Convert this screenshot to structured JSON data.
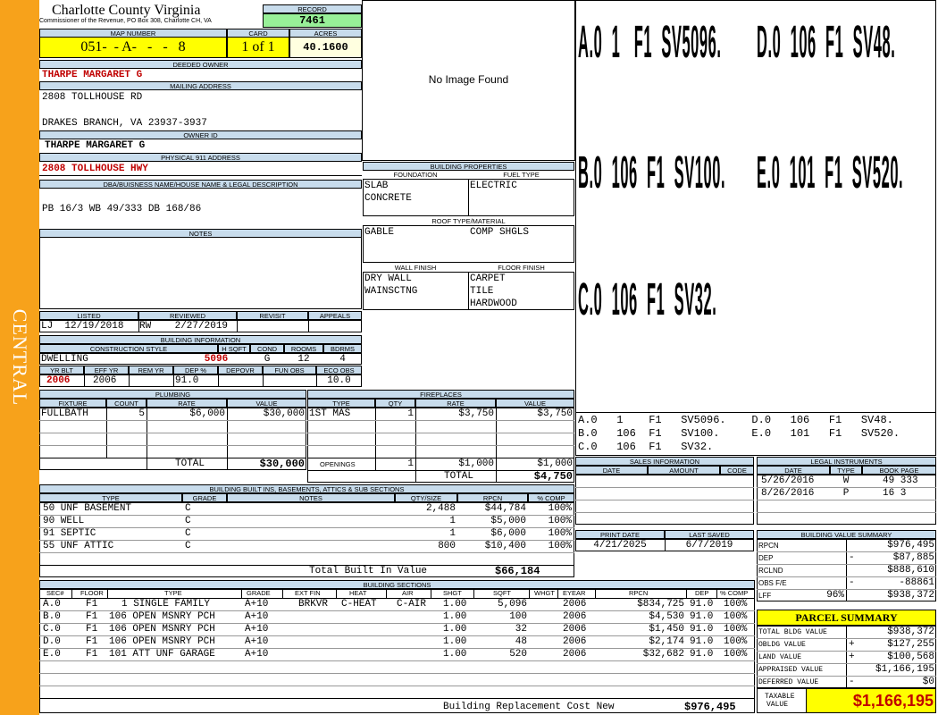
{
  "sidebar": {
    "label": "CENTRAL"
  },
  "county": {
    "name": "Charlotte County Virginia",
    "address": "Commissioner of the Revenue, PO Box 308, Charlotte CH, VA"
  },
  "record": {
    "label": "RECORD",
    "value": "7461"
  },
  "map": {
    "label": "MAP NUMBER",
    "value": "051-  - A-   -   -   8"
  },
  "card": {
    "label": "CARD",
    "value": "1 of 1"
  },
  "acres": {
    "label": "ACRES",
    "value": "40.1600"
  },
  "owner": {
    "deeded_label": "DEEDED OWNER",
    "deeded": "THARPE MARGARET G",
    "mailing_label": "MAILING ADDRESS",
    "mail1": "2808 TOLLHOUSE RD",
    "mail2": "DRAKES BRANCH, VA 23937-3937",
    "ownerid_label": "OWNER ID",
    "ownerid": "THARPE MARGARET G",
    "phys_label": "PHYSICAL 911 ADDRESS",
    "phys": "2808 TOLLHOUSE HWY"
  },
  "legal": {
    "label": "DBA/BUISNESS NAME/HOUSE NAME & LEGAL DESCRIPTION",
    "text": "PB 16/3 WB 49/333 DB 168/86"
  },
  "notes": {
    "label": "NOTES"
  },
  "listed": {
    "listed_label": "LISTED",
    "reviewed_label": "REVIEWED",
    "revisit_label": "REVISIT",
    "appeals_label": "APPEALS",
    "listed": "LJ  12/19/2018",
    "reviewed": "RW    2/27/2019"
  },
  "bldg_info": {
    "label": "BUILDING INFORMATION",
    "style_label": "CONSTRUCTION STYLE",
    "hsqft_label": "H SQFT",
    "cond_label": "COND",
    "rooms_label": "ROOMS",
    "bdrms_label": "BDRMS",
    "style": "DWELLING",
    "hsqft": "5096",
    "cond": "G",
    "rooms": "12",
    "bdrms": "4",
    "yrblt_label": "YR BLT",
    "effyr_label": "EFF YR",
    "remyr_label": "REM YR",
    "dep_label": "DEP %",
    "depovr_label": "DEPOVR",
    "funobs_label": "FUN OBS",
    "ecoobs_label": "ECO OBS",
    "yrblt": "2006",
    "effyr": "2006",
    "dep": "91.0",
    "ecoobs": "10.0"
  },
  "image": {
    "text": "No Image Found"
  },
  "bldg_props": {
    "label": "BUILDING PROPERTIES",
    "foundation_label": "FOUNDATION",
    "fuel_label": "FUEL TYPE",
    "foundation1": "SLAB",
    "foundation2": "CONCRETE",
    "fuel": "ELECTRIC",
    "roof_label": "ROOF TYPE/MATERIAL",
    "roof1": "GABLE",
    "roof2": "COMP SHGLS",
    "wall_label": "WALL FINISH",
    "floor_label": "FLOOR FINISH",
    "wall1": "DRY WALL",
    "wall2": "WAINSCTNG",
    "floor1": "CARPET",
    "floor2": "TILE",
    "floor3": "HARDWOOD"
  },
  "sketch": {
    "big1": "A.0  1   F1  SV5096.",
    "big1b": "D.0  106  F1  SV48.",
    "big2": "B.0  106  F1  SV100.",
    "big2b": "E.0  101  F1  SV520.",
    "big3": "C.0  106  F1  SV32.",
    "s1": "A.0   1    F1   SV5096.    D.0   106   F1   SV48.",
    "s2": "B.0   106  F1   SV100.     E.0   101   F1   SV520.",
    "s3": "C.0   106  F1   SV32."
  },
  "plumbing": {
    "label": "PLUMBING",
    "fixture_label": "FIXTURE",
    "count_label": "COUNT",
    "rate_label": "RATE",
    "value_label": "VALUE",
    "fixture": "FULLBATH",
    "count": "5",
    "rate": "$6,000",
    "value": "$30,000",
    "total_label": "TOTAL",
    "total": "$30,000"
  },
  "fireplaces": {
    "label": "FIREPLACES",
    "type_label": "TYPE",
    "qty_label": "QTY",
    "rate_label": "RATE",
    "value_label": "VALUE",
    "type": "1ST MAS",
    "qty": "1",
    "rate": "$3,750",
    "value": "$3,750",
    "open_label": "OPENINGS",
    "open_qty": "1",
    "open_rate": "$1,000",
    "open_value": "$1,000",
    "total_label": "TOTAL",
    "total": "$4,750"
  },
  "sales": {
    "label": "SALES INFORMATION",
    "date_label": "DATE",
    "amount_label": "AMOUNT",
    "code_label": "CODE"
  },
  "legal_inst": {
    "label": "LEGAL INSTRUMENTS",
    "date_label": "DATE",
    "type_label": "TYPE",
    "book_label": "BOOK PAGE",
    "rows": [
      {
        "date": "5/26/2016",
        "type": "W",
        "book": "49 333"
      },
      {
        "date": "8/26/2016",
        "type": "P",
        "book": "16 3"
      }
    ]
  },
  "print": {
    "print_label": "PRINT DATE",
    "saved_label": "LAST SAVED",
    "print_date": "4/21/2025",
    "saved": "6/7/2019"
  },
  "builtins": {
    "label": "BUILDING BUILT INS, BASEMENTS, ATTICS & SUB SECTIONS",
    "type_label": "TYPE",
    "grade_label": "GRADE",
    "notes_label": "NOTES",
    "qty_label": "QTY/SIZE",
    "rpcn_label": "RPCN",
    "comp_label": "% COMP",
    "rows": [
      {
        "type": "50 UNF BASEMENT",
        "grade": "C",
        "qty": "2,488",
        "rpcn": "$44,784",
        "comp": "100%"
      },
      {
        "type": "90 WELL",
        "grade": "C",
        "qty": "1",
        "rpcn": "$5,000",
        "comp": "100%"
      },
      {
        "type": "91 SEPTIC",
        "grade": "C",
        "qty": "1",
        "rpcn": "$6,000",
        "comp": "100%"
      },
      {
        "type": "55 UNF ATTIC",
        "grade": "C",
        "qty": "800",
        "rpcn": "$10,400",
        "comp": "100%"
      }
    ],
    "total_label": "Total Built In Value",
    "total": "$66,184"
  },
  "bvs": {
    "label": "BUILDING VALUE SUMMARY",
    "rows": [
      {
        "label": "RPCN",
        "sign": "",
        "value": "$976,495"
      },
      {
        "label": "DEP",
        "sign": "-",
        "value": "$87,885"
      },
      {
        "label": "RCLND",
        "sign": "",
        "value": "$888,610"
      },
      {
        "label": "OBS F/E",
        "sign": "-",
        "value": "-88861"
      },
      {
        "label": "LFF",
        "pct": "96%",
        "sign": "",
        "value": "$938,372"
      }
    ]
  },
  "sections": {
    "label": "BUILDING SECTIONS",
    "headers": [
      "SEC#",
      "FLOOR",
      "TYPE",
      "GRADE",
      "EXT FIN",
      "HEAT",
      "AIR",
      "SHGT",
      "SQFT",
      "WHGT",
      "EYEAR",
      "RPCN",
      "DEP",
      "% COMP"
    ],
    "rows": [
      {
        "sec": "A.0",
        "floor": "F1",
        "type": "1 SINGLE FAMILY",
        "grade": "A+10",
        "ext": "BRKVR",
        "heat": "C-HEAT",
        "air": "C-AIR",
        "shgt": "1.00",
        "sqft": "5,096",
        "eyear": "2006",
        "rpcn": "$834,725",
        "dep": "91.0",
        "comp": "100%"
      },
      {
        "sec": "B.0",
        "floor": "F1",
        "type": "106 OPEN MSNRY PCH",
        "grade": "A+10",
        "ext": "",
        "heat": "",
        "air": "",
        "shgt": "1.00",
        "sqft": "100",
        "eyear": "2006",
        "rpcn": "$4,530",
        "dep": "91.0",
        "comp": "100%"
      },
      {
        "sec": "C.0",
        "floor": "F1",
        "type": "106 OPEN MSNRY PCH",
        "grade": "A+10",
        "ext": "",
        "heat": "",
        "air": "",
        "shgt": "1.00",
        "sqft": "32",
        "eyear": "2006",
        "rpcn": "$1,450",
        "dep": "91.0",
        "comp": "100%"
      },
      {
        "sec": "D.0",
        "floor": "F1",
        "type": "106 OPEN MSNRY PCH",
        "grade": "A+10",
        "ext": "",
        "heat": "",
        "air": "",
        "shgt": "1.00",
        "sqft": "48",
        "eyear": "2006",
        "rpcn": "$2,174",
        "dep": "91.0",
        "comp": "100%"
      },
      {
        "sec": "E.0",
        "floor": "F1",
        "type": "101 ATT UNF GARAGE",
        "grade": "A+10",
        "ext": "",
        "heat": "",
        "air": "",
        "shgt": "1.00",
        "sqft": "520",
        "eyear": "2006",
        "rpcn": "$32,682",
        "dep": "91.0",
        "comp": "100%"
      }
    ],
    "brcn_label": "Building Replacement Cost New",
    "brcn": "$976,495"
  },
  "parcel": {
    "label": "PARCEL SUMMARY",
    "rows": [
      {
        "label": "TOTAL BLDG VALUE",
        "sign": "",
        "value": "$938,372"
      },
      {
        "label": "OBLDG VALUE",
        "sign": "+",
        "value": "$127,255"
      },
      {
        "label": "LAND VALUE",
        "sign": "+",
        "value": "$100,568"
      },
      {
        "label": "APPRAISED VALUE",
        "sign": "",
        "value": "$1,166,195"
      },
      {
        "label": "DEFERRED VALUE",
        "sign": "-",
        "value": "$0"
      }
    ],
    "taxable_label1": "TAXABLE",
    "taxable_label2": "VALUE",
    "taxable": "$1,166,195"
  },
  "colors": {
    "sidebar": "#f7a21b",
    "header": "#c8dcec",
    "yellow": "#ffff00",
    "record": "#98f098",
    "red": "#c00000"
  }
}
